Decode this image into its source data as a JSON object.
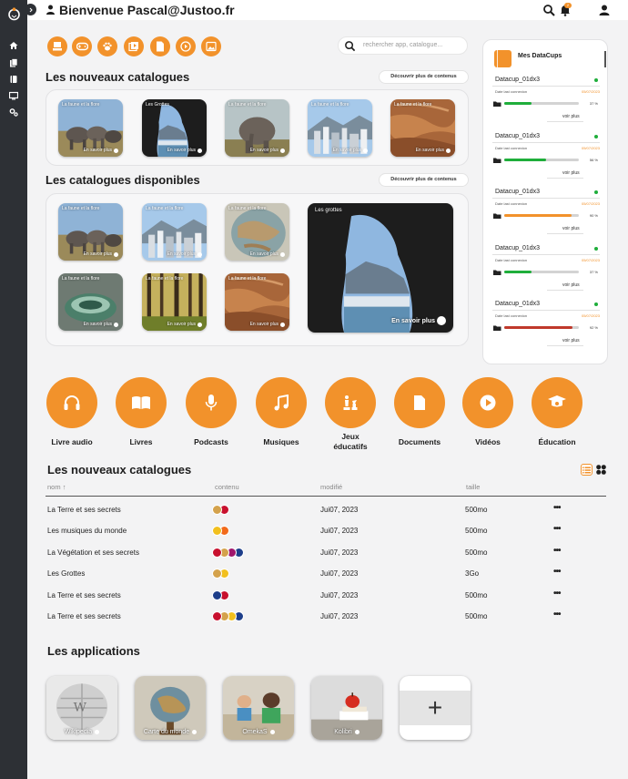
{
  "header": {
    "greeting": "Bienvenue Pascal@Justoo.fr",
    "notification_count": "2"
  },
  "search": {
    "placeholder": "rechercher app, catalogue..."
  },
  "colors": {
    "accent": "#f2922b",
    "sidebar": "#2d3035",
    "green": "#1fae3b",
    "red": "#c0392b"
  },
  "top_categories": [
    "graduation-cap-icon",
    "gamepad-icon",
    "paw-icon",
    "video-library-icon",
    "document-icon",
    "play-icon",
    "image-icon"
  ],
  "new_catalogs": {
    "title": "Les nouveaux catalogues",
    "more_label": "Découvrir plus de contenus",
    "cards": [
      {
        "title": "La faune et la flore",
        "more": "En savoir plus",
        "image": "elephants"
      },
      {
        "title": "Les Grottes",
        "more": "En savoir plus",
        "image": "cave"
      },
      {
        "title": "La faune et la flore",
        "more": "En savoir plus",
        "image": "elephant"
      },
      {
        "title": "La faune et la flore",
        "more": "En savoir plus",
        "image": "city"
      },
      {
        "title": "La faune et la flore",
        "more": "En savoir plus",
        "image": "rock"
      }
    ]
  },
  "available_catalogs": {
    "title": "Les catalogues disponibles",
    "more_label": "Découvrir plus de contenus",
    "cards": [
      {
        "title": "La faune et la flore",
        "more": "En savoir plus",
        "image": "elephants"
      },
      {
        "title": "La faune et la flore",
        "more": "En savoir plus",
        "image": "city"
      },
      {
        "title": "La faune et la flore",
        "more": "En savoir plus",
        "image": "globe"
      },
      {
        "title": "La faune et la flore",
        "more": "En savoir plus",
        "image": "bowls"
      },
      {
        "title": "La faune et la flore",
        "more": "En savoir plus",
        "image": "forest"
      },
      {
        "title": "La faune et la flore",
        "more": "En savoir plus",
        "image": "rock"
      }
    ],
    "featured": {
      "title": "Les grottes",
      "more": "En savoir plus",
      "image": "cave"
    }
  },
  "datacups": {
    "title": "Mes DataCups",
    "items": [
      {
        "name": "Datacup_01dx3",
        "label": "Date last connexion",
        "date": "05/07/2023",
        "percent": 37,
        "pct_label": "37 %",
        "color": "#1fae3b",
        "more": "voir plus"
      },
      {
        "name": "Datacup_01dx3",
        "label": "Date last connexion",
        "date": "05/07/2023",
        "percent": 56,
        "pct_label": "56 %",
        "color": "#1fae3b",
        "more": "voir plus"
      },
      {
        "name": "Datacup_01dx3",
        "label": "Date last connexion",
        "date": "05/07/2023",
        "percent": 90,
        "pct_label": "90 %",
        "color": "#f2922b",
        "more": "voir plus"
      },
      {
        "name": "Datacup_01dx3",
        "label": "Date last connexion",
        "date": "05/07/2023",
        "percent": 37,
        "pct_label": "37 %",
        "color": "#1fae3b",
        "more": "voir plus"
      },
      {
        "name": "Datacup_01dx3",
        "label": "Date last connexion",
        "date": "05/07/2023",
        "percent": 92,
        "pct_label": "92 %",
        "color": "#c0392b",
        "more": "voir plus"
      }
    ]
  },
  "big_categories": [
    {
      "label": "Livre audio",
      "icon": "headphones-icon"
    },
    {
      "label": "Livres",
      "icon": "book-icon"
    },
    {
      "label": "Podcasts",
      "icon": "microphone-icon"
    },
    {
      "label": "Musiques",
      "icon": "music-note-icon"
    },
    {
      "label": "Jeux\néducatifs",
      "icon": "chess-icon"
    },
    {
      "label": "Documents",
      "icon": "document-icon"
    },
    {
      "label": "Vidéos",
      "icon": "play-icon"
    },
    {
      "label": "Éducation",
      "icon": "graduation-cap-icon"
    }
  ],
  "table": {
    "title": "Les nouveaux catalogues",
    "columns": [
      "nom",
      "contenu",
      "modifié",
      "taille"
    ],
    "sort_indicator": "↑",
    "rows": [
      {
        "name": "La Terre et ses secrets",
        "colors": [
          "#d4a24c",
          "#c8102e"
        ],
        "modified": "Jui07, 2023",
        "size": "500mo"
      },
      {
        "name": "Les musiques du monde",
        "colors": [
          "#f2c01e",
          "#f26a1b"
        ],
        "modified": "Jui07, 2023",
        "size": "500mo"
      },
      {
        "name": "La Végétation et ses secrets",
        "colors": [
          "#c8102e",
          "#d4a24c",
          "#a0156b",
          "#1d3e8a"
        ],
        "modified": "Jui07, 2023",
        "size": "500mo"
      },
      {
        "name": "Les Grottes",
        "colors": [
          "#d4a24c",
          "#f2c01e"
        ],
        "modified": "Jui07, 2023",
        "size": "3Go"
      },
      {
        "name": "La Terre et ses secrets",
        "colors": [
          "#1d3e8a",
          "#c8102e"
        ],
        "modified": "Jui07, 2023",
        "size": "500mo"
      },
      {
        "name": "La Terre et ses secrets",
        "colors": [
          "#c8102e",
          "#d4a24c",
          "#f2c01e",
          "#1d3e8a"
        ],
        "modified": "Jui07, 2023",
        "size": "500mo"
      }
    ],
    "row_actions": "•••"
  },
  "apps": {
    "title": "Les applications",
    "items": [
      {
        "label": "Wikipedia",
        "image": "wikipedia"
      },
      {
        "label": "Carte du monde",
        "image": "globe-class"
      },
      {
        "label": "OmekaS",
        "image": "kids"
      },
      {
        "label": "Kolibri",
        "image": "apple"
      }
    ],
    "add_label": "+"
  }
}
